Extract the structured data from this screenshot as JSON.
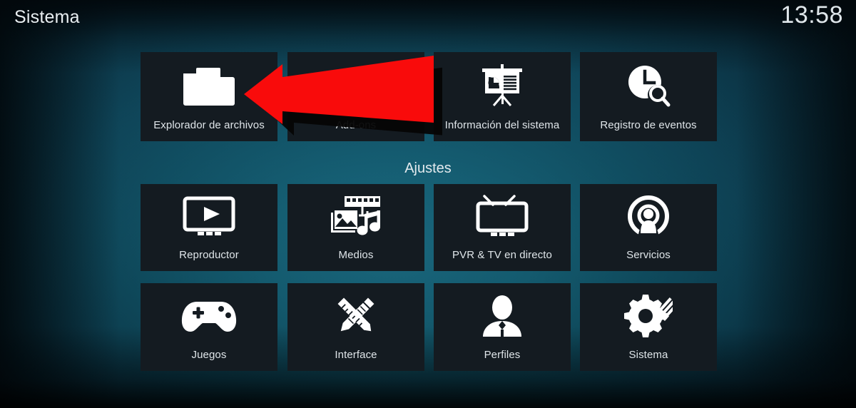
{
  "header": {
    "title": "Sistema",
    "clock": "13:58"
  },
  "sections": [
    {
      "name": "top",
      "label": "",
      "tiles": [
        {
          "label": "Explorador de archivos",
          "icon": "folder-icon"
        },
        {
          "label": "Add-ons",
          "icon": "addons-icon"
        },
        {
          "label": "Información del sistema",
          "icon": "presentation-board-icon"
        },
        {
          "label": "Registro de eventos",
          "icon": "clock-search-icon"
        }
      ]
    },
    {
      "name": "ajustes",
      "label": "Ajustes",
      "tiles": [
        {
          "label": "Reproductor",
          "icon": "tv-play-icon"
        },
        {
          "label": "Medios",
          "icon": "media-library-icon"
        },
        {
          "label": "PVR & TV en directo",
          "icon": "tv-antenna-icon"
        },
        {
          "label": "Servicios",
          "icon": "broadcast-person-icon"
        },
        {
          "label": "Juegos",
          "icon": "gamepad-icon"
        },
        {
          "label": "Interface",
          "icon": "pencil-ruler-icon"
        },
        {
          "label": "Perfiles",
          "icon": "person-icon"
        },
        {
          "label": "Sistema",
          "icon": "gear-wrench-icon"
        }
      ]
    }
  ],
  "annotation": {
    "type": "arrow",
    "direction": "left",
    "points_to": "Explorador de archivos",
    "color": "#f90b0b",
    "shadow_color": "#050505"
  },
  "colors": {
    "tile_background": "#141b21",
    "text": "#dfe5e9",
    "background_accent": "#125568",
    "arrow_red": "#f90b0b"
  }
}
